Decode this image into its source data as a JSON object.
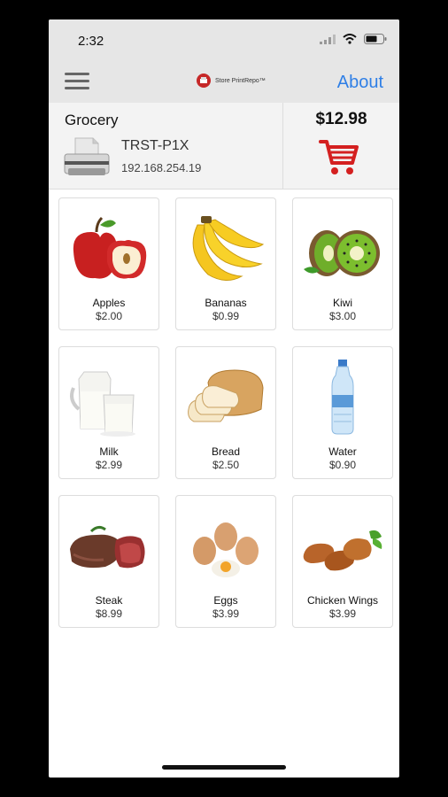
{
  "status": {
    "time": "2:32"
  },
  "navbar": {
    "logo_text": "Store PrintRepo™",
    "about_label": "About"
  },
  "header": {
    "store_name": "Grocery",
    "printer_name": "TRST-P1X",
    "printer_ip": "192.168.254.19",
    "cart_total": "$12.98"
  },
  "products": [
    {
      "name": "Apples",
      "price": "$2.00",
      "icon": "apple-icon"
    },
    {
      "name": "Bananas",
      "price": "$0.99",
      "icon": "banana-icon"
    },
    {
      "name": "Kiwi",
      "price": "$3.00",
      "icon": "kiwi-icon"
    },
    {
      "name": "Milk",
      "price": "$2.99",
      "icon": "milk-icon"
    },
    {
      "name": "Bread",
      "price": "$2.50",
      "icon": "bread-icon"
    },
    {
      "name": "Water",
      "price": "$0.90",
      "icon": "water-bottle-icon"
    },
    {
      "name": "Steak",
      "price": "$8.99",
      "icon": "steak-icon"
    },
    {
      "name": "Eggs",
      "price": "$3.99",
      "icon": "eggs-icon"
    },
    {
      "name": "Chicken Wings",
      "price": "$3.99",
      "icon": "chicken-wings-icon"
    }
  ],
  "colors": {
    "accent": "#2f7fe6",
    "cart": "#d42020",
    "navbar_bg": "#e6e6e6"
  }
}
